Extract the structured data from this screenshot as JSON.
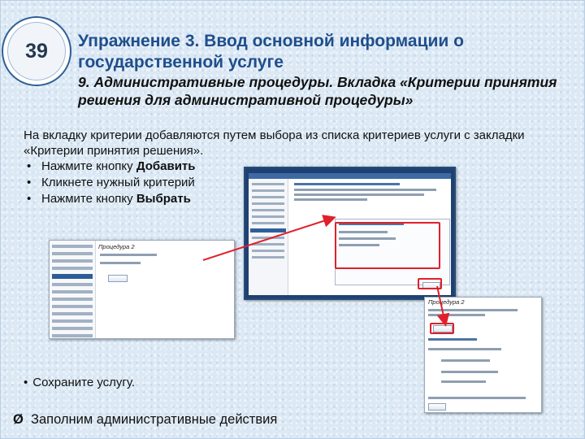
{
  "slide": {
    "number": "39",
    "title": "Упражнение 3. Ввод основной информации о государственной услуге",
    "subtitle": "9. Административные процедуры. Вкладка «Критерии принятия решения для административной процедуры»",
    "intro": "На вкладку критерии добавляются путем выбора из списка критериев услуги с закладки «Критерии принятия решения».",
    "bullets": [
      {
        "prefix": "Нажмите кнопку ",
        "bold": "Добавить"
      },
      {
        "prefix": "Кликнете нужный критерий",
        "bold": ""
      },
      {
        "prefix": "Нажмите кнопку ",
        "bold": "Выбрать"
      }
    ],
    "save_item": "Сохраните услугу.",
    "final_item": "Заполним административные действия",
    "bullet_glyph": "•",
    "arrow_glyph": "Ø"
  },
  "screens": {
    "b_heading": "Процедура 2",
    "c_heading": "Процедура 2"
  },
  "colors": {
    "accent": "#1f4e8c",
    "highlight": "#e0202a",
    "background": "#dce9f5"
  }
}
